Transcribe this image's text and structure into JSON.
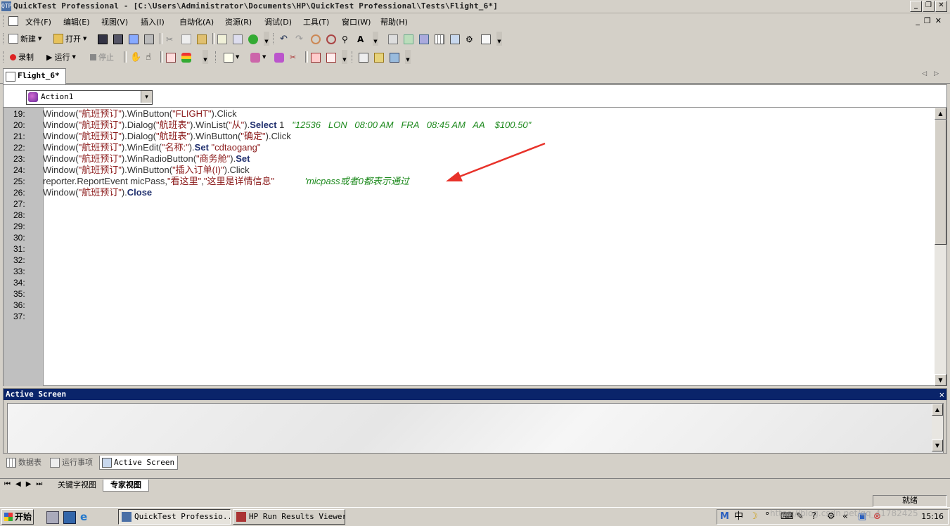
{
  "window": {
    "title": "QuickTest Professional - [C:\\Users\\Administrator\\Documents\\HP\\QuickTest Professional\\Tests\\Flight_6*]",
    "app_icon_text": "QTP"
  },
  "menu": [
    "文件(F)",
    "编辑(E)",
    "视图(V)",
    "插入(I)",
    "自动化(A)",
    "资源(R)",
    "调试(D)",
    "工具(T)",
    "窗口(W)",
    "帮助(H)"
  ],
  "toolbar1": {
    "new_label": "新建",
    "open_label": "打开"
  },
  "toolbar2": {
    "record_label": "录制",
    "run_label": "运行",
    "stop_label": "停止"
  },
  "document_tab": "Flight_6*",
  "action_select": {
    "value": "Action1"
  },
  "editor": {
    "lines": [
      {
        "num": "19:",
        "parts": [
          [
            "obj",
            "Window("
          ],
          [
            "str",
            "\"航班预订\""
          ],
          [
            "obj",
            ").WinButton("
          ],
          [
            "str",
            "\"FLIGHT\""
          ],
          [
            "obj",
            ").Click"
          ]
        ]
      },
      {
        "num": "20:",
        "parts": [
          [
            "obj",
            "Window("
          ],
          [
            "str",
            "\"航班预订\""
          ],
          [
            "obj",
            ").Dialog("
          ],
          [
            "str",
            "\"航班表\""
          ],
          [
            "obj",
            ").WinList("
          ],
          [
            "str",
            "\"从\""
          ],
          [
            "obj",
            ")."
          ],
          [
            "kw",
            "Select"
          ],
          [
            "obj",
            " 1   "
          ],
          [
            "cm",
            "\"12536   LON   08:00 AM   FRA   08:45 AM   AA    $100.50\""
          ]
        ]
      },
      {
        "num": "21:",
        "parts": [
          [
            "obj",
            "Window("
          ],
          [
            "str",
            "\"航班预订\""
          ],
          [
            "obj",
            ").Dialog("
          ],
          [
            "str",
            "\"航班表\""
          ],
          [
            "obj",
            ").WinButton("
          ],
          [
            "str",
            "\"确定\""
          ],
          [
            "obj",
            ").Click"
          ]
        ]
      },
      {
        "num": "22:",
        "parts": [
          [
            "obj",
            "Window("
          ],
          [
            "str",
            "\"航班预订\""
          ],
          [
            "obj",
            ").WinEdit("
          ],
          [
            "str",
            "\"名称:\""
          ],
          [
            "obj",
            ")."
          ],
          [
            "kw",
            "Set"
          ],
          [
            "obj",
            " "
          ],
          [
            "str",
            "\"cdtaogang\""
          ]
        ]
      },
      {
        "num": "23:",
        "parts": [
          [
            "obj",
            "Window("
          ],
          [
            "str",
            "\"航班预订\""
          ],
          [
            "obj",
            ").WinRadioButton("
          ],
          [
            "str",
            "\"商务舱\""
          ],
          [
            "obj",
            ")."
          ],
          [
            "kw",
            "Set"
          ]
        ]
      },
      {
        "num": "24:",
        "parts": [
          [
            "obj",
            "Window("
          ],
          [
            "str",
            "\"航班预订\""
          ],
          [
            "obj",
            ").WinButton("
          ],
          [
            "str",
            "\"插入订单(I)\""
          ],
          [
            "obj",
            ").Click"
          ]
        ]
      },
      {
        "num": "25:",
        "parts": [
          [
            "obj",
            "reporter.ReportEvent micPass,"
          ],
          [
            "str",
            "\"看这里\""
          ],
          [
            "obj",
            ","
          ],
          [
            "str",
            "\"这里是详情信息\""
          ],
          [
            "obj",
            "            "
          ],
          [
            "cm",
            "'micpass或者0都表示通过"
          ]
        ]
      },
      {
        "num": "26:",
        "parts": [
          [
            "obj",
            "Window("
          ],
          [
            "str",
            "\"航班预订\""
          ],
          [
            "obj",
            ")."
          ],
          [
            "kw",
            "Close"
          ]
        ]
      },
      {
        "num": "27:",
        "parts": []
      },
      {
        "num": "28:",
        "parts": []
      },
      {
        "num": "29:",
        "parts": []
      },
      {
        "num": "30:",
        "parts": []
      },
      {
        "num": "31:",
        "parts": []
      },
      {
        "num": "32:",
        "parts": []
      },
      {
        "num": "33:",
        "parts": []
      },
      {
        "num": "34:",
        "parts": []
      },
      {
        "num": "35:",
        "parts": []
      },
      {
        "num": "36:",
        "parts": []
      },
      {
        "num": "37:",
        "parts": []
      }
    ]
  },
  "active_screen": {
    "title": "Active Screen",
    "close": "✕"
  },
  "bottom_tabs": [
    "数据表",
    "运行事项",
    "Active Screen"
  ],
  "view_tabs": [
    "关键字视图",
    "专家视图"
  ],
  "status": "就绪",
  "taskbar": {
    "start": "开始",
    "tasks": [
      "QuickTest Professio...",
      "HP Run Results Viewer"
    ],
    "clock": "15:16",
    "tray_ime": "中"
  },
  "watermark": "https://blog.csdn.net/qq_41782425",
  "colors": {
    "title_active": "#0a246a",
    "keyword": "#1f2f6e",
    "string": "#8b1a1a",
    "comment": "#1e8a1e",
    "arrow": "#e8322a"
  }
}
